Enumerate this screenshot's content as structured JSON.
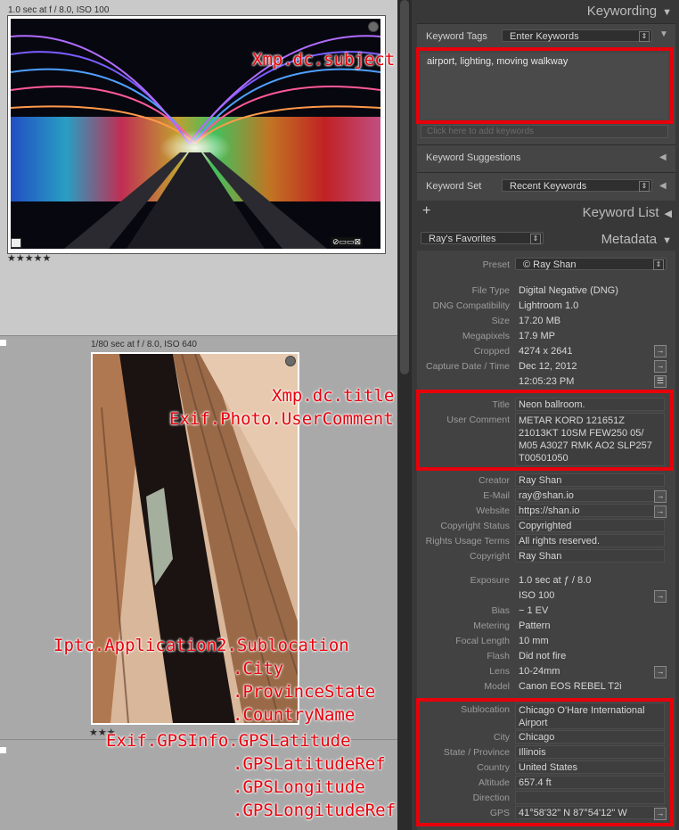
{
  "grid": {
    "photo1": {
      "caption": "1.0 sec at f / 8.0, ISO 100",
      "stars": "★★★★★"
    },
    "photo2": {
      "caption": "1/80 sec at f / 8.0, ISO 640",
      "stars": "★★★"
    }
  },
  "panel": {
    "keywording": {
      "header": "Keywording",
      "tags_label": "Keyword Tags",
      "tags_select": "Enter Keywords",
      "keywords_text": "airport, lighting, moving walkway",
      "add_placeholder": "Click here to add keywords",
      "suggestions_label": "Keyword Suggestions",
      "set_label": "Keyword Set",
      "set_select": "Recent Keywords"
    },
    "keyword_list": {
      "header": "Keyword List",
      "plus": "+"
    },
    "metadata": {
      "header": "Metadata",
      "favorites_select": "Ray's Favorites",
      "preset_label": "Preset",
      "preset_value": "© Ray Shan",
      "rows": [
        {
          "label": "File Type",
          "value": "Digital Negative (DNG)"
        },
        {
          "label": "DNG Compatibility",
          "value": "Lightroom 1.0"
        },
        {
          "label": "Size",
          "value": "17.20 MB"
        },
        {
          "label": "Megapixels",
          "value": "17.9 MP"
        },
        {
          "label": "Cropped",
          "value": "4274 x 2641"
        },
        {
          "label": "Capture Date / Time",
          "value": "Dec 12, 2012"
        },
        {
          "label": "",
          "value": "12:05:23 PM"
        }
      ],
      "title_label": "Title",
      "title_value": "Neon ballroom.",
      "comment_label": "User Comment",
      "comment_value": "METAR KORD 121651Z 21013KT 10SM FEW250 05/ M05 A3027 RMK AO2 SLP257 T00501050",
      "creator_rows": [
        {
          "label": "Creator",
          "value": "Ray Shan"
        },
        {
          "label": "E-Mail",
          "value": "ray@shan.io"
        },
        {
          "label": "Website",
          "value": "https://shan.io"
        },
        {
          "label": "Copyright Status",
          "value": "Copyrighted"
        },
        {
          "label": "Rights Usage Terms",
          "value": "All rights reserved."
        },
        {
          "label": "Copyright",
          "value": "Ray Shan"
        }
      ],
      "exposure_rows": [
        {
          "label": "Exposure",
          "value": "1.0 sec at ƒ / 8.0"
        },
        {
          "label": "",
          "value": "ISO 100"
        },
        {
          "label": "Bias",
          "value": "− 1 EV"
        },
        {
          "label": "Metering",
          "value": "Pattern"
        },
        {
          "label": "Focal Length",
          "value": "10 mm"
        },
        {
          "label": "Flash",
          "value": "Did not fire"
        },
        {
          "label": "Lens",
          "value": "10-24mm"
        },
        {
          "label": "Model",
          "value": "Canon EOS REBEL T2i"
        }
      ],
      "location_rows": [
        {
          "label": "Sublocation",
          "value": "Chicago O'Hare International Airport"
        },
        {
          "label": "City",
          "value": "Chicago"
        },
        {
          "label": "State / Province",
          "value": "Illinois"
        },
        {
          "label": "Country",
          "value": "United States"
        },
        {
          "label": "Altitude",
          "value": "657.4 ft"
        },
        {
          "label": "Direction",
          "value": ""
        },
        {
          "label": "GPS",
          "value": "41°58'32\" N 87°54'12\" W"
        }
      ]
    }
  },
  "annotations": {
    "subject": "Xmp.dc.subject",
    "title": "Xmp.dc.title",
    "usercomment": "Exif.Photo.UserComment",
    "sublocation": "Iptc.Application2.Sublocation",
    "city": ".City",
    "province": ".ProvinceState",
    "country": ".CountryName",
    "lat": "Exif.GPSInfo.GPSLatitude",
    "latref": ".GPSLatitudeRef",
    "lon": ".GPSLongitude",
    "lonref": ".GPSLongitudeRef"
  },
  "colors": {
    "annotation": "#e8000b",
    "panel": "#383838",
    "grid_selected": "#c9c9c9"
  }
}
